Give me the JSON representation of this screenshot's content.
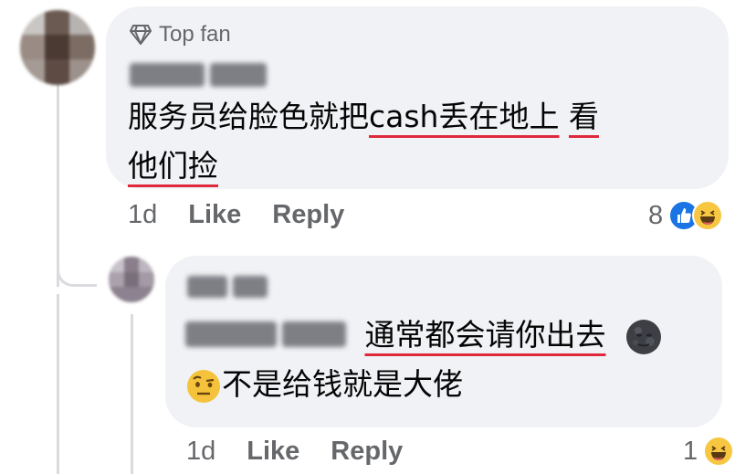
{
  "comment1": {
    "badge": "Top fan",
    "author_blurred": true,
    "text_plain": "服务员给脸色就把",
    "text_underlined_1": "cash丢在地上",
    "text_space": " ",
    "text_underlined_2": "看",
    "text_line2_underlined": "他们捡",
    "time": "1d",
    "like_label": "Like",
    "reply_label": "Reply",
    "reaction_count": "8",
    "reaction_icons": [
      "like-icon",
      "haha-icon"
    ]
  },
  "reply1": {
    "author_blurred": true,
    "mention_blurred": true,
    "text_underlined": "通常都会请你出去",
    "emoji_after": "new-moon-face-emoji",
    "emoji_before_line2": "raised-eyebrow-emoji",
    "text_line2": "不是给钱就是大佬",
    "time": "1d",
    "like_label": "Like",
    "reply_label": "Reply",
    "reaction_count": "1",
    "reaction_icons": [
      "haha-icon"
    ]
  },
  "colors": {
    "bubble": "#f0f2f5",
    "meta_text": "#65676b",
    "underline": "#e0283b",
    "like_blue": "#1b74e4",
    "haha_yellow": "#f7c742"
  }
}
